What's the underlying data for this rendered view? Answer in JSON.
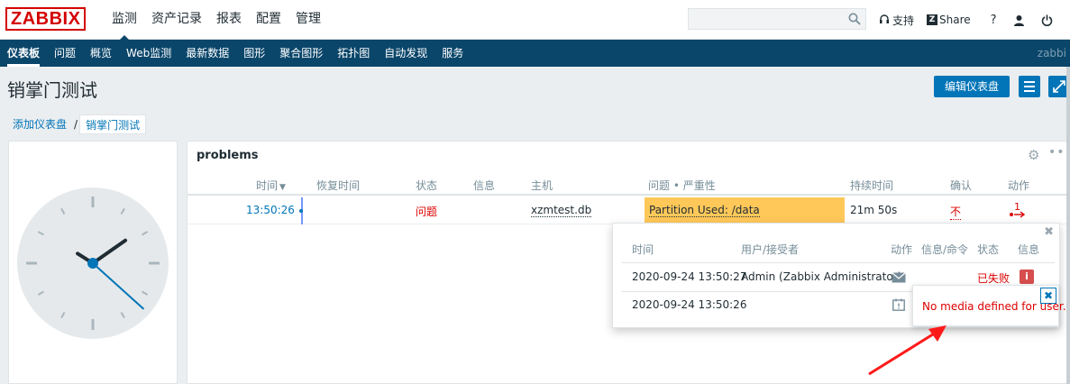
{
  "brand": {
    "logo": "ZABBIX"
  },
  "main_menu": [
    {
      "label": "监测",
      "active": true
    },
    {
      "label": "资产记录",
      "active": false
    },
    {
      "label": "报表",
      "active": false
    },
    {
      "label": "配置",
      "active": false
    },
    {
      "label": "管理",
      "active": false
    }
  ],
  "search": {
    "placeholder": "",
    "icon": "search-icon"
  },
  "top_links": {
    "support": "支持",
    "share": "Share",
    "share_glyph": "Z",
    "help": "?"
  },
  "sub_nav": [
    {
      "label": "仪表板",
      "active": true
    },
    {
      "label": "问题"
    },
    {
      "label": "概览"
    },
    {
      "label": "Web监测"
    },
    {
      "label": "最新数据"
    },
    {
      "label": "图形"
    },
    {
      "label": "聚合图形"
    },
    {
      "label": "拓扑图"
    },
    {
      "label": "自动发现"
    },
    {
      "label": "服务"
    }
  ],
  "sub_nav_user": "zabbi",
  "page": {
    "title": "销掌门测试",
    "edit_button": "编辑仪表盘"
  },
  "breadcrumb": {
    "parent": "添加仪表盘",
    "separator": "/",
    "current": "销掌门测试"
  },
  "clock": {
    "hour": 1,
    "minute": 50,
    "second": 22
  },
  "problems_widget": {
    "title": "problems",
    "columns": {
      "time": "时间",
      "recovery_time": "恢复时间",
      "status": "状态",
      "info": "信息",
      "host": "主机",
      "problem_severity": "问题 • 严重性",
      "duration": "持续时间",
      "ack": "确认",
      "actions": "动作"
    },
    "rows": [
      {
        "time": "13:50:26",
        "recovery_time": "",
        "status": "问题",
        "info": "",
        "host": "xzmtest.db",
        "problem": "Partition Used: /data",
        "duration": "21m 50s",
        "ack": "不",
        "actions": "1"
      }
    ]
  },
  "actions_popup": {
    "columns": {
      "time": "时间",
      "user": "用户/接受者",
      "action": "动作",
      "message": "信息/命令",
      "status": "状态",
      "info": "信息"
    },
    "rows": [
      {
        "time": "2020-09-24 13:50:27",
        "user": "Admin (Zabbix Administrator)",
        "action_icon": "mail-icon",
        "status": "已失败",
        "info": "i"
      },
      {
        "time": "2020-09-24 13:50:26",
        "user": "",
        "action_icon": "calendar-icon",
        "status": "",
        "info": ""
      }
    ]
  },
  "hint": {
    "text": "No media defined for user."
  },
  "colors": {
    "nav": "#0a466a",
    "accent": "#0275b8",
    "problem_bg": "#ffc859",
    "error": "#dc0000",
    "logo": "#d40000"
  }
}
